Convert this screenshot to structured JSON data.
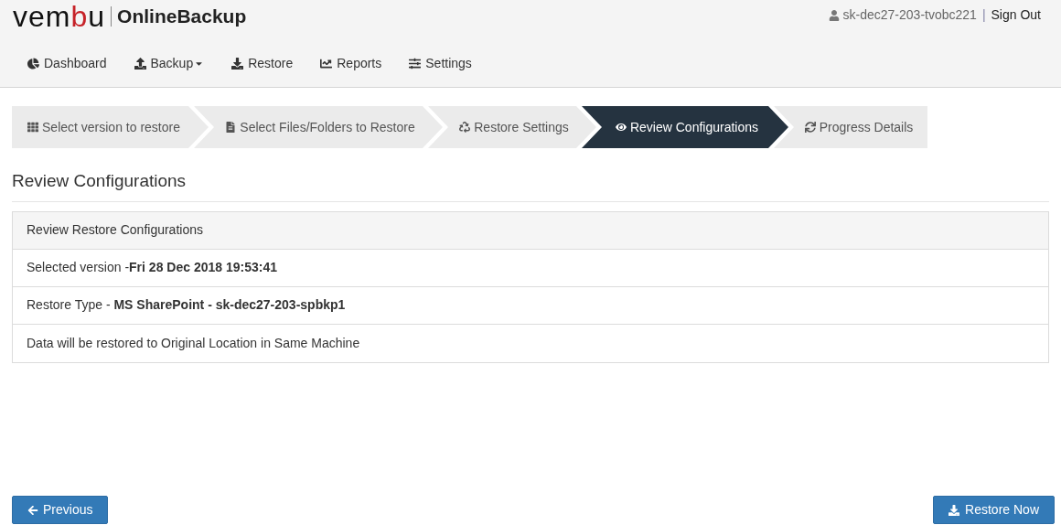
{
  "header": {
    "logo": [
      {
        "text": "vem",
        "accent": false
      },
      {
        "text": "b",
        "accent": true
      },
      {
        "text": "u",
        "accent": false
      }
    ],
    "product": "OnlineBackup",
    "user": "sk-dec27-203-tvobc221",
    "separator": "|",
    "sign_out": "Sign Out"
  },
  "nav": [
    {
      "label": "Dashboard",
      "dropdown": false
    },
    {
      "label": "Backup",
      "dropdown": true
    },
    {
      "label": "Restore",
      "dropdown": false
    },
    {
      "label": "Reports",
      "dropdown": false
    },
    {
      "label": "Settings",
      "dropdown": false
    }
  ],
  "steps": [
    {
      "label": "Select version to restore",
      "selected": false
    },
    {
      "label": "Select Files/Folders to Restore",
      "selected": false
    },
    {
      "label": "Restore Settings",
      "selected": false
    },
    {
      "label": "Review Configurations",
      "selected": true
    },
    {
      "label": "Progress Details",
      "selected": false
    }
  ],
  "section_title": "Review Configurations",
  "panel": {
    "heading": "Review Restore Configurations",
    "rows": [
      "Selected version -**Fri 28 Dec 2018 19:53:41**",
      "Restore Type - **MS SharePoint - sk-dec27-203-spbkp1**",
      "Data will be restored to Original Location in Same Machine"
    ]
  },
  "buttons": {
    "previous": "Previous",
    "restore_now": "Restore Now"
  }
}
